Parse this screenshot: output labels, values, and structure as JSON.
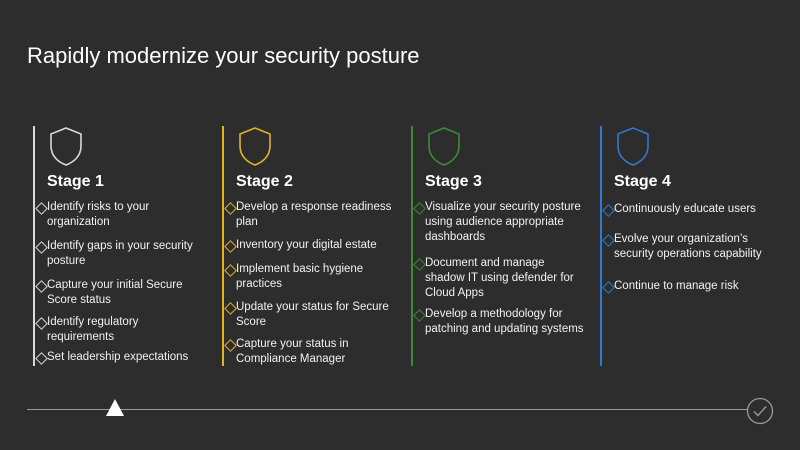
{
  "title": "Rapidly modernize your security posture",
  "stages": [
    {
      "label": "Stage 1",
      "color": "#d9d9d9",
      "items": [
        "Identify risks to your organization",
        "Identify gaps in your security posture",
        "Capture your initial Secure Score status",
        "Identify regulatory requirements",
        "Set leadership expectations"
      ]
    },
    {
      "label": "Stage 2",
      "color": "#e3b325",
      "items": [
        "Develop a response readiness plan",
        "Inventory your digital estate",
        "Implement basic hygiene practices",
        "Update your status for Secure Score",
        "Capture your status in Compliance Manager"
      ]
    },
    {
      "label": "Stage 3",
      "color": "#3f8a36",
      "items": [
        "Visualize your security posture using audience appropriate dashboards",
        "Document and manage shadow IT using defender for Cloud Apps",
        "Develop a methodology for patching and updating systems"
      ]
    },
    {
      "label": "Stage 4",
      "color": "#2f7ad1",
      "items": [
        "Continuously educate users",
        "Evolve your organization’s security operations capability",
        "Continue to manage risk"
      ]
    }
  ],
  "icons": {
    "stage": "shield-icon",
    "progress_marker": "triangle-icon",
    "end": "checkmark-circle-icon"
  }
}
